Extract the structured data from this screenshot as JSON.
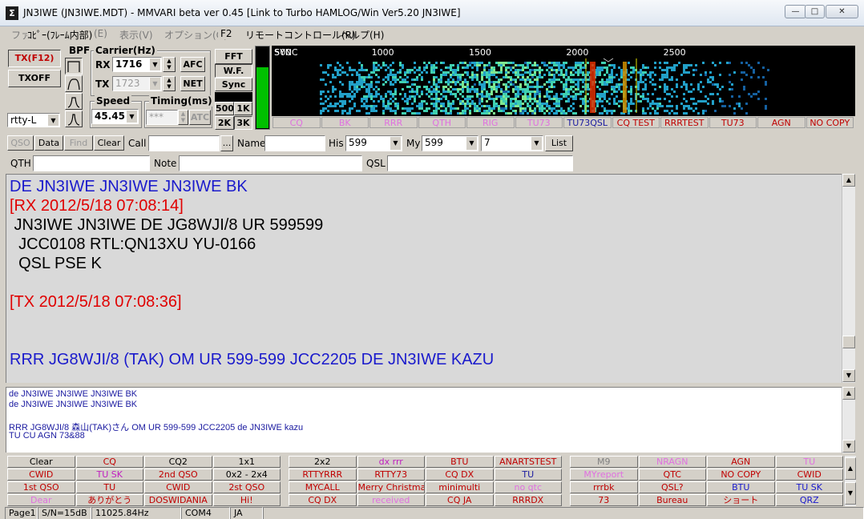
{
  "window": {
    "title": "JN3IWE (JN3IWE.MDT) - MMVARI beta ver 0.45 [Link to Turbo HAMLOG/Win Ver5.20 JN3IWE]",
    "minimize": "—",
    "maximize": "□",
    "close": "✕"
  },
  "menu": {
    "file": "ファイル(F)",
    "overlay": "ｺﾋﾟｰ(ﾌﾚｰﾑ内部)",
    "edit": "(E)",
    "view": "表示(V)",
    "options": "オプション(O)",
    "f2": "F2",
    "remote": "リモートコントロール(R)",
    "help": "ヘルプ(H)"
  },
  "controls": {
    "tx_button": "TX(F12)",
    "txoff_button": "TXOFF",
    "bpf_label": "BPF",
    "carrier_label": "Carrier(Hz)",
    "rx_label": "RX",
    "rx_value": "1716",
    "tx_label": "TX",
    "tx_value": "1723",
    "afc_button": "AFC",
    "net_button": "NET",
    "speed_label": "Speed",
    "speed_value": "45.45",
    "timing_label": "Timing(ms)",
    "timing_value": "***",
    "atc_button": "ATC",
    "mode_value": "rtty-L",
    "fft_button": "FFT",
    "wf_button": "W.F.",
    "sync_button": "Sync",
    "span_500": "500",
    "span_1k": "1K",
    "span_2k": "2K",
    "span_3k": "3K"
  },
  "waterfall": {
    "sync_label": "SYNC",
    "ticks": [
      "500",
      "1000",
      "1500",
      "2000",
      "2500"
    ]
  },
  "macros_top": [
    {
      "label": "CQ",
      "color": "#e070e0"
    },
    {
      "label": "BK",
      "color": "#e070e0"
    },
    {
      "label": "RRR",
      "color": "#e070e0"
    },
    {
      "label": "QTH",
      "color": "#e070e0"
    },
    {
      "label": "RIG",
      "color": "#e070e0"
    },
    {
      "label": "TU73",
      "color": "#e070e0"
    },
    {
      "label": "TU73QSL",
      "color": "#1a1aa0"
    },
    {
      "label": "CQ TEST",
      "color": "#c00000"
    },
    {
      "label": "RRRTEST",
      "color": "#c00000"
    },
    {
      "label": "TU73",
      "color": "#c00000"
    },
    {
      "label": "AGN",
      "color": "#c00000"
    },
    {
      "label": "NO COPY",
      "color": "#c00000"
    }
  ],
  "log": {
    "qso_button": "QSO",
    "data_button": "Data",
    "find_button": "Find",
    "clear_button": "Clear",
    "call_label": "Call",
    "call_value": "",
    "more_button": "...",
    "name_label": "Name",
    "name_value": "",
    "his_label": "His",
    "his_value": "599",
    "my_label": "My",
    "my_value": "599",
    "band_value": "7",
    "list_button": "List",
    "qth_label": "QTH",
    "qth_value": "",
    "note_label": "Note",
    "note_value": "",
    "qsl_label": "QSL",
    "qsl_value": ""
  },
  "rx_text": [
    {
      "text": "DE JN3IWE JN3IWE JN3IWE BK",
      "color": "#1a1acc"
    },
    {
      "text": "[RX 2012/5/18 07:08:14]",
      "color": "#e00000"
    },
    {
      "text": " JN3IWE JN3IWE DE JG8WJI/8 UR 599599",
      "color": "#000000"
    },
    {
      "text": "  JCC0108 RTL:QN13XU YU-0166",
      "color": "#000000"
    },
    {
      "text": "  QSL PSE K",
      "color": "#000000"
    },
    {
      "text": "",
      "color": "#000000"
    },
    {
      "text": "[TX 2012/5/18 07:08:36]",
      "color": "#e00000"
    },
    {
      "text": "",
      "color": "#000000"
    },
    {
      "text": "",
      "color": "#000000"
    },
    {
      "text": "RRR JG8WJI/8 (TAK) OM UR 599-599 JCC2205 DE JN3IWE KAZU",
      "color": "#1a1acc"
    }
  ],
  "tx_text": [
    "de JN3IWE JN3IWE JN3IWE BK",
    "de JN3IWE JN3IWE JN3IWE BK",
    "",
    "RRR JG8WJI/8 森山(TAK)さん OM UR 599-599 JCC2205 de JN3IWE kazu",
    "TU CU AGN 73&88"
  ],
  "macro_grid": [
    [
      {
        "label": "Clear",
        "color": "#000000"
      },
      {
        "label": "CQ",
        "color": "#c00000"
      },
      {
        "label": "CQ2",
        "color": "#000000"
      },
      {
        "label": "1x1",
        "color": "#000000"
      },
      {
        "label": "2x2",
        "color": "#000000"
      },
      {
        "label": "dx rrr",
        "color": "#c020c0"
      },
      {
        "label": "BTU",
        "color": "#c00000"
      },
      {
        "label": "ANARTSTEST",
        "color": "#c00000"
      },
      {
        "label": "M9",
        "color": "#808080"
      },
      {
        "label": "NRAGN",
        "color": "#e070e0"
      },
      {
        "label": "AGN",
        "color": "#c00000"
      },
      {
        "label": "TU",
        "color": "#e070e0"
      }
    ],
    [
      {
        "label": "CWID",
        "color": "#c00000"
      },
      {
        "label": "TU SK",
        "color": "#c020c0"
      },
      {
        "label": "2nd QSO",
        "color": "#c00000"
      },
      {
        "label": "0x2 - 2x4",
        "color": "#000000"
      },
      {
        "label": "RTTYRRR",
        "color": "#c00000"
      },
      {
        "label": "RTTY73",
        "color": "#c00000"
      },
      {
        "label": "CQ DX",
        "color": "#c00000"
      },
      {
        "label": "TU",
        "color": "#1a1aa0"
      },
      {
        "label": "MYreport",
        "color": "#e070e0"
      },
      {
        "label": "QTC",
        "color": "#c00000"
      },
      {
        "label": "NO COPY",
        "color": "#c00000"
      },
      {
        "label": "CWID",
        "color": "#c00000"
      }
    ],
    [
      {
        "label": "1st QSO",
        "color": "#c00000"
      },
      {
        "label": "TU",
        "color": "#c00000"
      },
      {
        "label": "CWID",
        "color": "#c00000"
      },
      {
        "label": "2st QSO",
        "color": "#c00000"
      },
      {
        "label": "MYCALL",
        "color": "#c00000"
      },
      {
        "label": "Merry Christmas",
        "color": "#c00000"
      },
      {
        "label": "minimulti",
        "color": "#c00000"
      },
      {
        "label": "no qtc",
        "color": "#e070e0"
      },
      {
        "label": "rrrbk",
        "color": "#c00000"
      },
      {
        "label": "QSL?",
        "color": "#c00000"
      },
      {
        "label": "BTU",
        "color": "#1a1acc"
      },
      {
        "label": "TU SK",
        "color": "#1a1acc"
      }
    ],
    [
      {
        "label": "Dear",
        "color": "#e070e0"
      },
      {
        "label": "ありがとう",
        "color": "#c00000"
      },
      {
        "label": "DOSWIDANIA",
        "color": "#c00000"
      },
      {
        "label": "Hi!",
        "color": "#c00000"
      },
      {
        "label": "CQ DX",
        "color": "#c00000"
      },
      {
        "label": "received",
        "color": "#e070e0"
      },
      {
        "label": "CQ JA",
        "color": "#c00000"
      },
      {
        "label": "RRRDX",
        "color": "#c00000"
      },
      {
        "label": "73",
        "color": "#c00000"
      },
      {
        "label": "Bureau",
        "color": "#c00000"
      },
      {
        "label": "ショート",
        "color": "#c00000"
      },
      {
        "label": "QRZ",
        "color": "#1a1acc"
      }
    ]
  ],
  "status": {
    "page": "Page1",
    "sn": "S/N=15dB",
    "clock": "11025.84Hz",
    "port": "COM4",
    "lang": "JA"
  }
}
